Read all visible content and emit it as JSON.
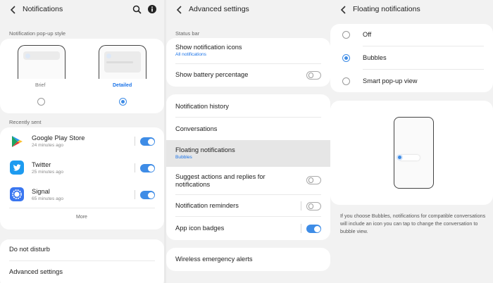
{
  "panel1": {
    "title": "Notifications",
    "popup_style_label": "Notification pop-up style",
    "styles": [
      {
        "label": "Brief",
        "selected": false
      },
      {
        "label": "Detailed",
        "selected": true
      }
    ],
    "recently_sent_label": "Recently sent",
    "apps": [
      {
        "name": "Google Play Store",
        "time": "24 minutes ago",
        "enabled": true,
        "icon": "google-play-icon"
      },
      {
        "name": "Twitter",
        "time": "25 minutes ago",
        "enabled": true,
        "icon": "twitter-icon"
      },
      {
        "name": "Signal",
        "time": "65 minutes ago",
        "enabled": true,
        "icon": "signal-icon"
      }
    ],
    "more_label": "More",
    "do_not_disturb": "Do not disturb",
    "advanced_settings": "Advanced settings"
  },
  "panel2": {
    "title": "Advanced settings",
    "status_bar_label": "Status bar",
    "show_icons_title": "Show notification icons",
    "show_icons_sub": "All notifications",
    "battery_title": "Show battery percentage",
    "battery_enabled": false,
    "history": "Notification history",
    "conversations": "Conversations",
    "floating_title": "Floating notifications",
    "floating_sub": "Bubbles",
    "suggest_line1": "Suggest actions and replies for",
    "suggest_line2": "notifications",
    "suggest_enabled": false,
    "reminders": "Notification reminders",
    "reminders_enabled": false,
    "badges": "App icon badges",
    "badges_enabled": true,
    "emergency": "Wireless emergency alerts"
  },
  "panel3": {
    "title": "Floating notifications",
    "options": [
      {
        "label": "Off",
        "selected": false
      },
      {
        "label": "Bubbles",
        "selected": true
      },
      {
        "label": "Smart pop-up view",
        "selected": false
      }
    ],
    "description": "If you choose Bubbles, notifications for compatible conversations will include an icon you can tap to change the conversation to bubble view."
  },
  "colors": {
    "accent": "#3e8ce6",
    "background": "#f2f2f2",
    "card": "#ffffff",
    "subtext_blue": "#1a73e8"
  }
}
